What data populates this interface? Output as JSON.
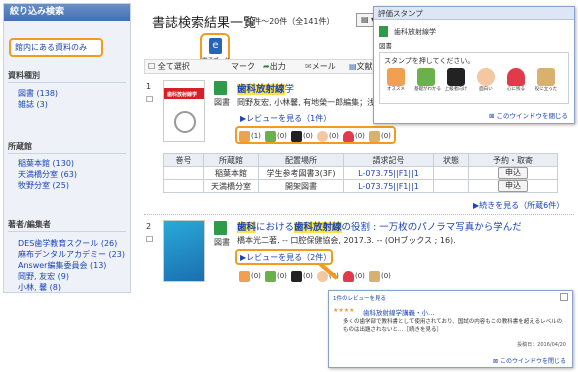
{
  "sidebar": {
    "header": "絞り込み検索",
    "library_filter": "館内にある資料のみ",
    "material_type": {
      "heading": "資料種別",
      "items": [
        {
          "label": "図書 (138)"
        },
        {
          "label": "雑誌 (3)"
        }
      ]
    },
    "location": {
      "heading": "所蔵館",
      "items": [
        {
          "label": "稲葉本館 (130)"
        },
        {
          "label": "天満橋分室 (63)"
        },
        {
          "label": "牧野分室 (25)"
        }
      ]
    },
    "author": {
      "heading": "著者/編集者",
      "items": [
        {
          "label": "DES歯学教育スクール (26)"
        },
        {
          "label": "麻布デンタルアカデミー (23)"
        },
        {
          "label": "Answer編集委員会 (13)"
        },
        {
          "label": "岡野, 友宏 (9)"
        },
        {
          "label": "小林, 馨 (8)"
        }
      ]
    }
  },
  "header": {
    "title": "書誌検索結果一覧",
    "count": "1件～20件（全141件）",
    "sort": "▤ ▾"
  },
  "toolbar": {
    "select_all": "全て選択",
    "mark": "マーク",
    "output": "出力",
    "mail": "メール",
    "bibtex": "文献"
  },
  "ebook_bubble": {
    "label": "電子ブック"
  },
  "results": [
    {
      "num": "1",
      "cover_text": "歯科放射線学",
      "type": "図書",
      "title_prefix": "",
      "title_highlight": "歯科放射線",
      "title_suffix": "学",
      "meta": "岡野友宏, 小林馨, 有地榮一郎編集；浅岡",
      "review_link": "▶レビューを見る（1件）",
      "stamps": [
        "(1)",
        "(0)",
        "(0)",
        "(0)",
        "(0)",
        "(0)"
      ],
      "holdings": {
        "headers": [
          "巻号",
          "所蔵館",
          "配置場所",
          "請求記号",
          "状態",
          "予約・取寄"
        ],
        "rows": [
          {
            "cells": [
              "",
              "稲葉本館",
              "学生参考図書3(3F)",
              "L-073.75||F1||1",
              "",
              "申込"
            ]
          },
          {
            "cells": [
              "",
              "天満橋分室",
              "開架図書",
              "L-073.75||F1||1",
              "",
              "申込"
            ]
          }
        ]
      },
      "more": "▶続きを見る（所蔵6件）"
    },
    {
      "num": "2",
      "type": "図書",
      "title_prefix": "",
      "title_highlight": "歯科",
      "title_mid": "における",
      "title_highlight2": "歯科放射線",
      "title_suffix": "の役割 : 一万枚のパノラマ写真から学んだ",
      "meta": "橋本光二著. -- 口腔保健協会, 2017.3. -- (OHブックス ; 16).",
      "review_link": "▶レビューを見る（2件）",
      "stamps": [
        "(0)",
        "(0)",
        "(0)",
        "(0)",
        "(0)",
        "(0)"
      ]
    }
  ],
  "popup_stamp": {
    "header": "評価スタンプ",
    "book_title": "歯科放射線学",
    "type": "図書",
    "prompt": "スタンプを押してください。",
    "stamps": [
      {
        "icon": "thumbs-up-icon",
        "label": "オススメ"
      },
      {
        "icon": "leaf-icon",
        "label": "基礎がわかる"
      },
      {
        "icon": "cap-icon",
        "label": "上級者向け"
      },
      {
        "icon": "face-icon",
        "label": "面白い"
      },
      {
        "icon": "heart-icon",
        "label": "心に残る"
      },
      {
        "icon": "book-icon",
        "label": "役に立った"
      }
    ],
    "close": "このウインドウを閉じる"
  },
  "popup_review": {
    "header": "1件のレビューを見る",
    "stars": "★★★★",
    "title": "歯科放射線学講義・小…",
    "body": "多くの歯学部で教科書として使用されており、国試の内容もこの教科書を超えるレベルのものは出題されないと…［続きを見る］",
    "date": "投稿日：2016/04/20",
    "close": "このウインドウを閉じる"
  },
  "colors": {
    "accent_orange": "#f39a1f",
    "link_blue": "#1a44b8",
    "highlight": "#ffe24a",
    "book_green": "#2f9a4a"
  }
}
